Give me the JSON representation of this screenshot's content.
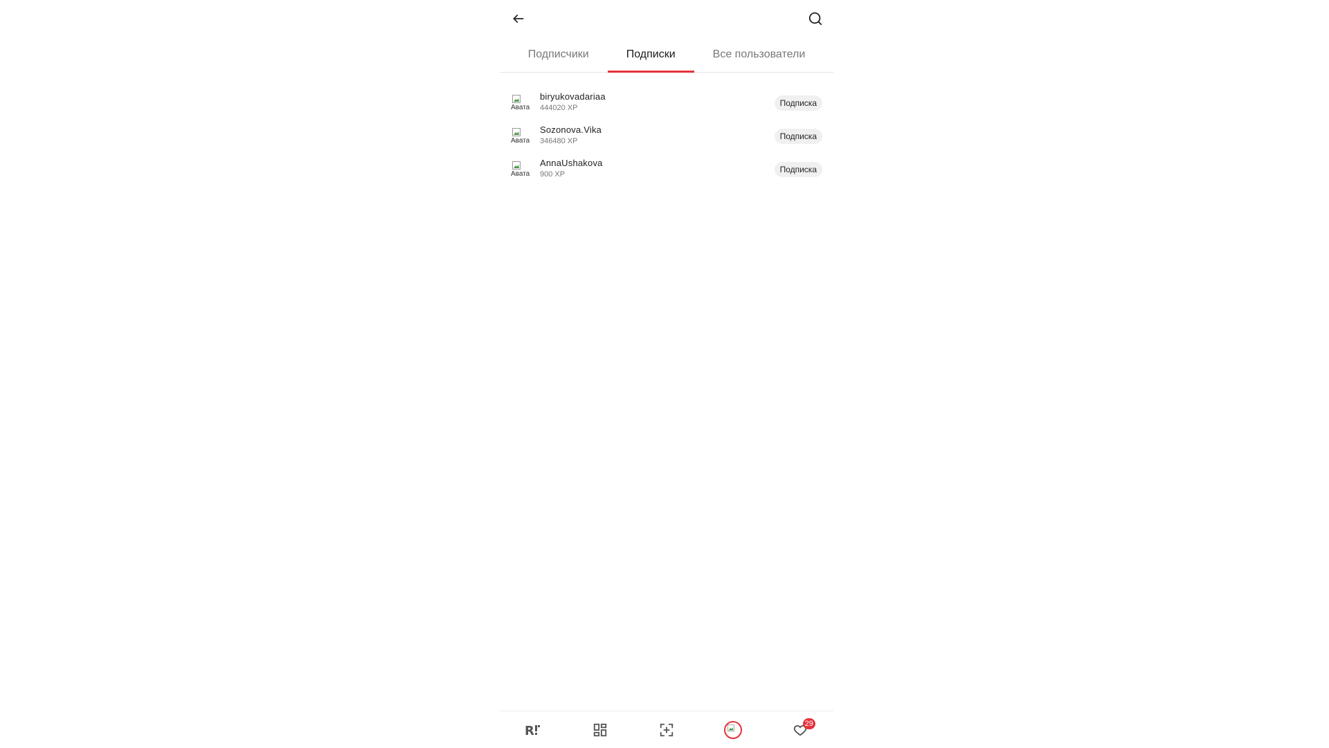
{
  "header": {
    "back_icon": "arrow-left-icon",
    "search_icon": "search-icon"
  },
  "tabs": [
    {
      "label": "Подписчики",
      "active": false
    },
    {
      "label": "Подписки",
      "active": true
    },
    {
      "label": "Все пользователи",
      "active": false
    }
  ],
  "users": [
    {
      "username": "biryukovadariaa",
      "xp": "444020 XP",
      "avatar_alt": "Авата",
      "button": "Подписка"
    },
    {
      "username": "Sozonova.Vika",
      "xp": "346480 XP",
      "avatar_alt": "Авата",
      "button": "Подписка"
    },
    {
      "username": "AnnaUshakova",
      "xp": "900 XP",
      "avatar_alt": "Авата",
      "button": "Подписка"
    }
  ],
  "bottom_nav": {
    "items": [
      {
        "name": "home",
        "icon": "brand-logo-icon"
      },
      {
        "name": "catalog",
        "icon": "grid-icon"
      },
      {
        "name": "scan",
        "icon": "scan-plus-icon"
      },
      {
        "name": "profile",
        "icon": "avatar-icon"
      },
      {
        "name": "favorites",
        "icon": "heart-icon"
      }
    ],
    "favorites_badge": "29"
  },
  "colors": {
    "accent": "#e3323b",
    "button_bg": "#f0f0f0",
    "muted_text": "#777777"
  }
}
